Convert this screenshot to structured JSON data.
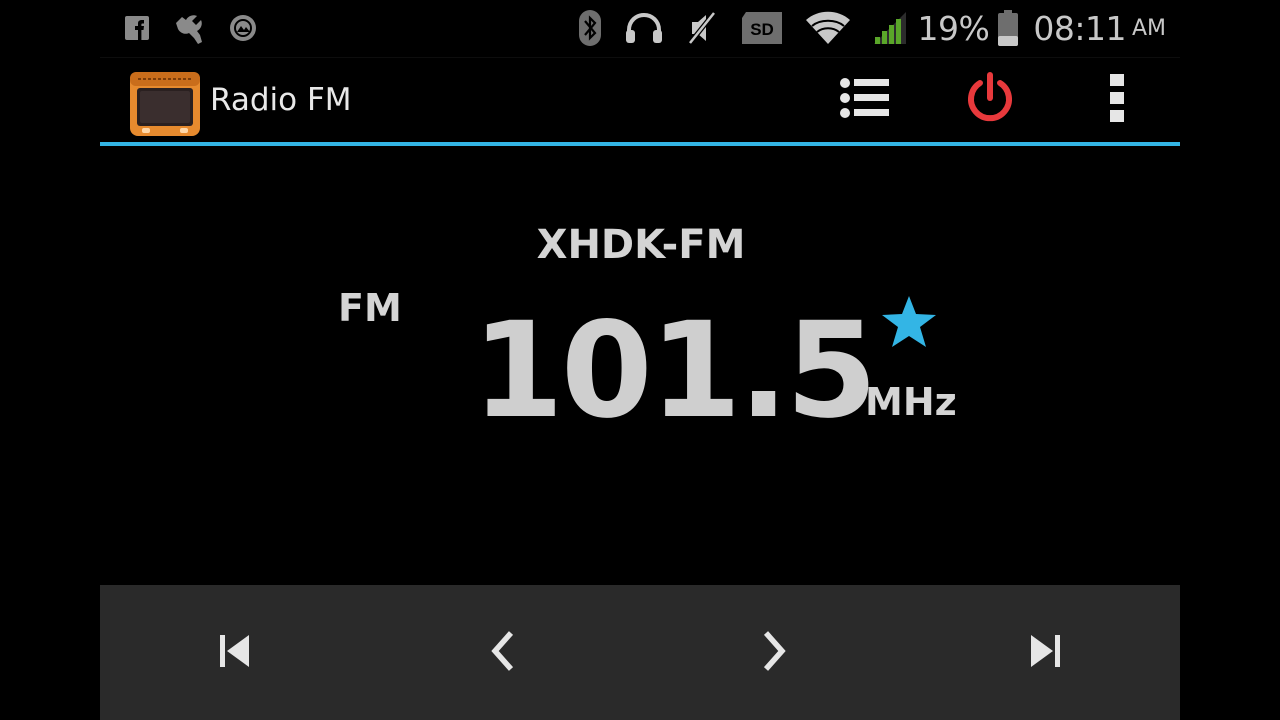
{
  "status_bar": {
    "left_icons": [
      "facebook-icon",
      "wrench-icon",
      "gallery-icon"
    ],
    "right_icons": [
      "bluetooth-icon",
      "headphones-icon",
      "mute-icon",
      "sd-card-icon",
      "wifi-icon",
      "signal-icon",
      "battery-icon"
    ],
    "sd_label": "SD",
    "battery_percent": "19%",
    "time": "08:11",
    "ampm": "AM"
  },
  "action_bar": {
    "app_title": "Radio FM",
    "app_icon": "radio-app-icon",
    "actions": [
      "station-list-icon",
      "power-icon",
      "overflow-menu-icon"
    ]
  },
  "tuner": {
    "station_name": "XHDK-FM",
    "band": "FM",
    "frequency": "101.5",
    "unit": "MHz",
    "favorite": true
  },
  "controls": [
    "previous-station-icon",
    "step-down-icon",
    "step-up-icon",
    "next-station-icon"
  ],
  "colors": {
    "accent": "#33b5e5",
    "power": "#e8393c",
    "favorite_star": "#33b5e5",
    "app_icon": "#e68a2e",
    "signal": "#5aa629",
    "control_bar": "#2a2a2a"
  }
}
